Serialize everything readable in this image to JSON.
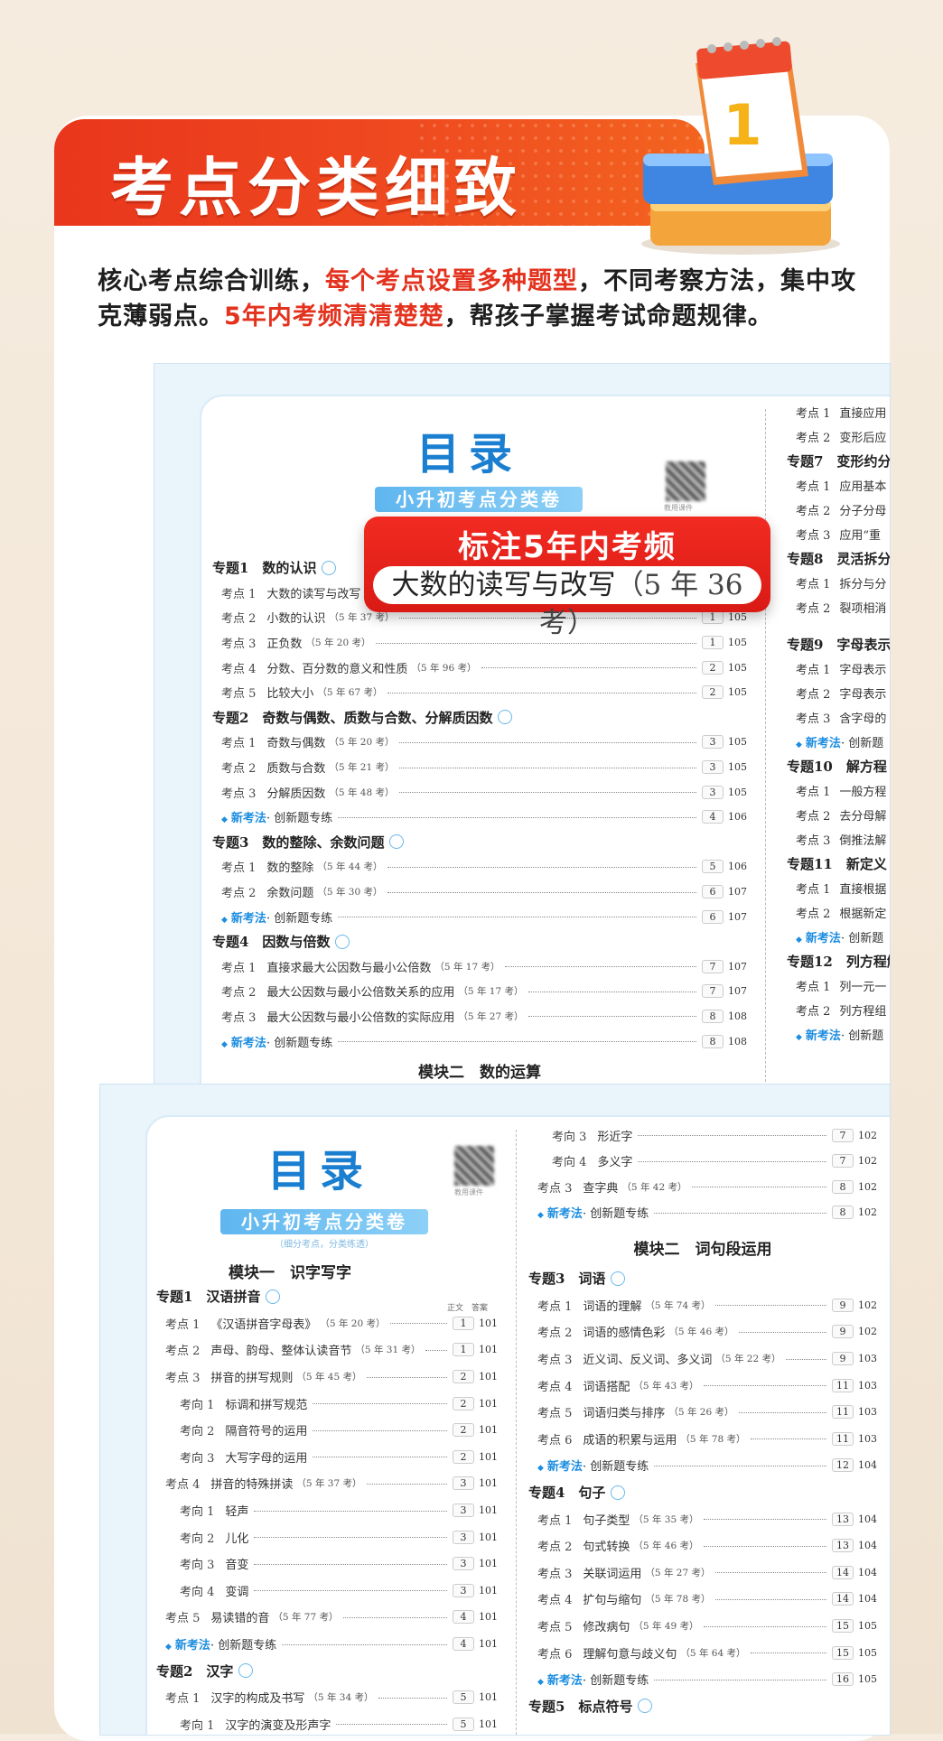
{
  "banner": {
    "title": "考点分类细致"
  },
  "intro": {
    "p1": "核心考点综合训练，",
    "p1_hl": "每个考点设置多种题型",
    "p1_tail": "，不同考察方法，集中攻克薄弱点。",
    "p2_hl": "5年内考频清清楚楚",
    "p2_tail": "，帮孩子掌握考试命题规律。"
  },
  "badge": {
    "title": "标注5年内考频",
    "example": "大数的读写与改写",
    "freq": "（5 年 36 考）"
  },
  "pageA": {
    "title": "目录",
    "subtitle": "小升初考点分类卷",
    "qr_caption": "教用课件",
    "module_footer": "模块二　数的运算",
    "left": [
      {
        "t": "topic",
        "text": "专题1　数的认识"
      },
      {
        "t": "kd",
        "k": "考点 1",
        "text": "大数的读写与改写",
        "f": "",
        "p": "1",
        "a": "105"
      },
      {
        "t": "kd",
        "k": "考点 2",
        "text": "小数的认识",
        "f": "（5 年 37 考）",
        "p": "1",
        "a": "105"
      },
      {
        "t": "kd",
        "k": "考点 3",
        "text": "正负数",
        "f": "（5 年 20 考）",
        "p": "1",
        "a": "105"
      },
      {
        "t": "kd",
        "k": "考点 4",
        "text": "分数、百分数的意义和性质",
        "f": "（5 年 96 考）",
        "p": "2",
        "a": "105"
      },
      {
        "t": "kd",
        "k": "考点 5",
        "text": "比较大小",
        "f": "（5 年 67 考）",
        "p": "2",
        "a": "105"
      },
      {
        "t": "topic",
        "text": "专题2　奇数与偶数、质数与合数、分解质因数"
      },
      {
        "t": "kd",
        "k": "考点 1",
        "text": "奇数与偶数",
        "f": "（5 年 20 考）",
        "p": "3",
        "a": "105"
      },
      {
        "t": "kd",
        "k": "考点 2",
        "text": "质数与合数",
        "f": "（5 年 21 考）",
        "p": "3",
        "a": "105"
      },
      {
        "t": "kd",
        "k": "考点 3",
        "text": "分解质因数",
        "f": "（5 年 48 考）",
        "p": "3",
        "a": "105"
      },
      {
        "t": "new",
        "tag": "新考法",
        "text": "· 创新题专练",
        "p": "4",
        "a": "106"
      },
      {
        "t": "topic",
        "text": "专题3　数的整除、余数问题"
      },
      {
        "t": "kd",
        "k": "考点 1",
        "text": "数的整除",
        "f": "（5 年 44 考）",
        "p": "5",
        "a": "106"
      },
      {
        "t": "kd",
        "k": "考点 2",
        "text": "余数问题",
        "f": "（5 年 30 考）",
        "p": "6",
        "a": "107"
      },
      {
        "t": "new",
        "tag": "新考法",
        "text": "· 创新题专练",
        "p": "6",
        "a": "107"
      },
      {
        "t": "topic",
        "text": "专题4　因数与倍数"
      },
      {
        "t": "kd",
        "k": "考点 1",
        "text": "直接求最大公因数与最小公倍数",
        "f": "（5 年 17 考）",
        "p": "7",
        "a": "107"
      },
      {
        "t": "kd",
        "k": "考点 2",
        "text": "最大公因数与最小公倍数关系的应用",
        "f": "（5 年 17 考）",
        "p": "7",
        "a": "107"
      },
      {
        "t": "kd",
        "k": "考点 3",
        "text": "最大公因数与最小公倍数的实际应用",
        "f": "（5 年 27 考）",
        "p": "8",
        "a": "108"
      },
      {
        "t": "new",
        "tag": "新考法",
        "text": "· 创新题专练",
        "p": "8",
        "a": "108"
      }
    ],
    "right": [
      {
        "t": "kd",
        "k": "考点 1",
        "text": "直接应用"
      },
      {
        "t": "kd",
        "k": "考点 2",
        "text": "变形后应"
      },
      {
        "t": "topic",
        "text": "专题7　变形约分"
      },
      {
        "t": "kd",
        "k": "考点 1",
        "text": "应用基本"
      },
      {
        "t": "kd",
        "k": "考点 2",
        "text": "分子分母"
      },
      {
        "t": "kd",
        "k": "考点 3",
        "text": "应用“重"
      },
      {
        "t": "topic",
        "text": "专题8　灵活拆分"
      },
      {
        "t": "kd",
        "k": "考点 1",
        "text": "拆分与分"
      },
      {
        "t": "kd",
        "k": "考点 2",
        "text": "裂项相消"
      },
      {
        "t": "gap"
      },
      {
        "t": "topic",
        "text": "专题9　字母表示"
      },
      {
        "t": "kd",
        "k": "考点 1",
        "text": "字母表示"
      },
      {
        "t": "kd",
        "k": "考点 2",
        "text": "字母表示"
      },
      {
        "t": "kd",
        "k": "考点 3",
        "text": "含字母的"
      },
      {
        "t": "new",
        "tag": "新考法",
        "text": "· 创新题"
      },
      {
        "t": "topic",
        "text": "专题10　解方程"
      },
      {
        "t": "kd",
        "k": "考点 1",
        "text": "一般方程"
      },
      {
        "t": "kd",
        "k": "考点 2",
        "text": "去分母解"
      },
      {
        "t": "kd",
        "k": "考点 3",
        "text": "倒推法解"
      },
      {
        "t": "topic",
        "text": "专题11　新定义"
      },
      {
        "t": "kd",
        "k": "考点 1",
        "text": "直接根据"
      },
      {
        "t": "kd",
        "k": "考点 2",
        "text": "根据新定"
      },
      {
        "t": "new",
        "tag": "新考法",
        "text": "· 创新题"
      },
      {
        "t": "topic",
        "text": "专题12　列方程解"
      },
      {
        "t": "kd",
        "k": "考点 1",
        "text": "列一元一"
      },
      {
        "t": "kd",
        "k": "考点 2",
        "text": "列方程组"
      },
      {
        "t": "new",
        "tag": "新考法",
        "text": "· 创新题"
      }
    ]
  },
  "pageB": {
    "title": "目录",
    "subtitle": "小升初考点分类卷",
    "subtitle_small": "（细分考点，分类练透）",
    "qr_caption": "教用课件",
    "module1": "模块一　识字写字",
    "col_headers": "正文　答案",
    "module2": "模块二　词句段运用",
    "left": [
      {
        "t": "topic",
        "text": "专题1　汉语拼音"
      },
      {
        "t": "kd",
        "k": "考点 1",
        "text": "《汉语拼音字母表》",
        "f": "（5 年 20 考）",
        "p": "1",
        "a": "101"
      },
      {
        "t": "kd",
        "k": "考点 2",
        "text": "声母、韵母、整体认读音节",
        "f": "（5 年 31 考）",
        "p": "1",
        "a": "101"
      },
      {
        "t": "kd",
        "k": "考点 3",
        "text": "拼音的拼写规则",
        "f": "（5 年 45 考）",
        "p": "2",
        "a": "101"
      },
      {
        "t": "kx",
        "k": "考向 1",
        "text": "标调和拼写规范",
        "f": "",
        "p": "2",
        "a": "101"
      },
      {
        "t": "kx",
        "k": "考向 2",
        "text": "隔音符号的运用",
        "f": "",
        "p": "2",
        "a": "101"
      },
      {
        "t": "kx",
        "k": "考向 3",
        "text": "大写字母的运用",
        "f": "",
        "p": "2",
        "a": "101"
      },
      {
        "t": "kd",
        "k": "考点 4",
        "text": "拼音的特殊拼读",
        "f": "（5 年 37 考）",
        "p": "3",
        "a": "101"
      },
      {
        "t": "kx",
        "k": "考向 1",
        "text": "轻声",
        "f": "",
        "p": "3",
        "a": "101"
      },
      {
        "t": "kx",
        "k": "考向 2",
        "text": "儿化",
        "f": "",
        "p": "3",
        "a": "101"
      },
      {
        "t": "kx",
        "k": "考向 3",
        "text": "音变",
        "f": "",
        "p": "3",
        "a": "101"
      },
      {
        "t": "kx",
        "k": "考向 4",
        "text": "变调",
        "f": "",
        "p": "3",
        "a": "101"
      },
      {
        "t": "kd",
        "k": "考点 5",
        "text": "易读错的音",
        "f": "（5 年 77 考）",
        "p": "4",
        "a": "101"
      },
      {
        "t": "new",
        "tag": "新考法",
        "text": "· 创新题专练",
        "p": "4",
        "a": "101"
      },
      {
        "t": "topic",
        "text": "专题2　汉字"
      },
      {
        "t": "kd",
        "k": "考点 1",
        "text": "汉字的构成及书写",
        "f": "（5 年 34 考）",
        "p": "5",
        "a": "101"
      },
      {
        "t": "kx",
        "k": "考向 1",
        "text": "汉字的演变及形声字",
        "f": "",
        "p": "5",
        "a": "101"
      }
    ],
    "right_top": [
      {
        "t": "kx",
        "k": "考向 3",
        "text": "形近字",
        "f": "",
        "p": "7",
        "a": "102"
      },
      {
        "t": "kx",
        "k": "考向 4",
        "text": "多义字",
        "f": "",
        "p": "7",
        "a": "102"
      },
      {
        "t": "kd",
        "k": "考点 3",
        "text": "查字典",
        "f": "（5 年 42 考）",
        "p": "8",
        "a": "102"
      },
      {
        "t": "new",
        "tag": "新考法",
        "text": "· 创新题专练",
        "p": "8",
        "a": "102"
      }
    ],
    "right_bottom": [
      {
        "t": "topic",
        "text": "专题3　词语"
      },
      {
        "t": "kd",
        "k": "考点 1",
        "text": "词语的理解",
        "f": "（5 年 74 考）",
        "p": "9",
        "a": "102"
      },
      {
        "t": "kd",
        "k": "考点 2",
        "text": "词语的感情色彩",
        "f": "（5 年 46 考）",
        "p": "9",
        "a": "102"
      },
      {
        "t": "kd",
        "k": "考点 3",
        "text": "近义词、反义词、多义词",
        "f": "（5 年 22 考）",
        "p": "9",
        "a": "103"
      },
      {
        "t": "kd",
        "k": "考点 4",
        "text": "词语搭配",
        "f": "（5 年 43 考）",
        "p": "11",
        "a": "103"
      },
      {
        "t": "kd",
        "k": "考点 5",
        "text": "词语归类与排序",
        "f": "（5 年 26 考）",
        "p": "11",
        "a": "103"
      },
      {
        "t": "kd",
        "k": "考点 6",
        "text": "成语的积累与运用",
        "f": "（5 年 78 考）",
        "p": "11",
        "a": "103"
      },
      {
        "t": "new",
        "tag": "新考法",
        "text": "· 创新题专练",
        "p": "12",
        "a": "104"
      },
      {
        "t": "topic",
        "text": "专题4　句子"
      },
      {
        "t": "kd",
        "k": "考点 1",
        "text": "句子类型",
        "f": "（5 年 35 考）",
        "p": "13",
        "a": "104"
      },
      {
        "t": "kd",
        "k": "考点 2",
        "text": "句式转换",
        "f": "（5 年 46 考）",
        "p": "13",
        "a": "104"
      },
      {
        "t": "kd",
        "k": "考点 3",
        "text": "关联词运用",
        "f": "（5 年 27 考）",
        "p": "14",
        "a": "104"
      },
      {
        "t": "kd",
        "k": "考点 4",
        "text": "扩句与缩句",
        "f": "（5 年 78 考）",
        "p": "14",
        "a": "104"
      },
      {
        "t": "kd",
        "k": "考点 5",
        "text": "修改病句",
        "f": "（5 年 49 考）",
        "p": "15",
        "a": "105"
      },
      {
        "t": "kd",
        "k": "考点 6",
        "text": "理解句意与歧义句",
        "f": "（5 年 64 考）",
        "p": "15",
        "a": "105"
      },
      {
        "t": "new",
        "tag": "新考法",
        "text": "· 创新题专练",
        "p": "16",
        "a": "105"
      },
      {
        "t": "topic",
        "text": "专题5　标点符号"
      }
    ]
  }
}
